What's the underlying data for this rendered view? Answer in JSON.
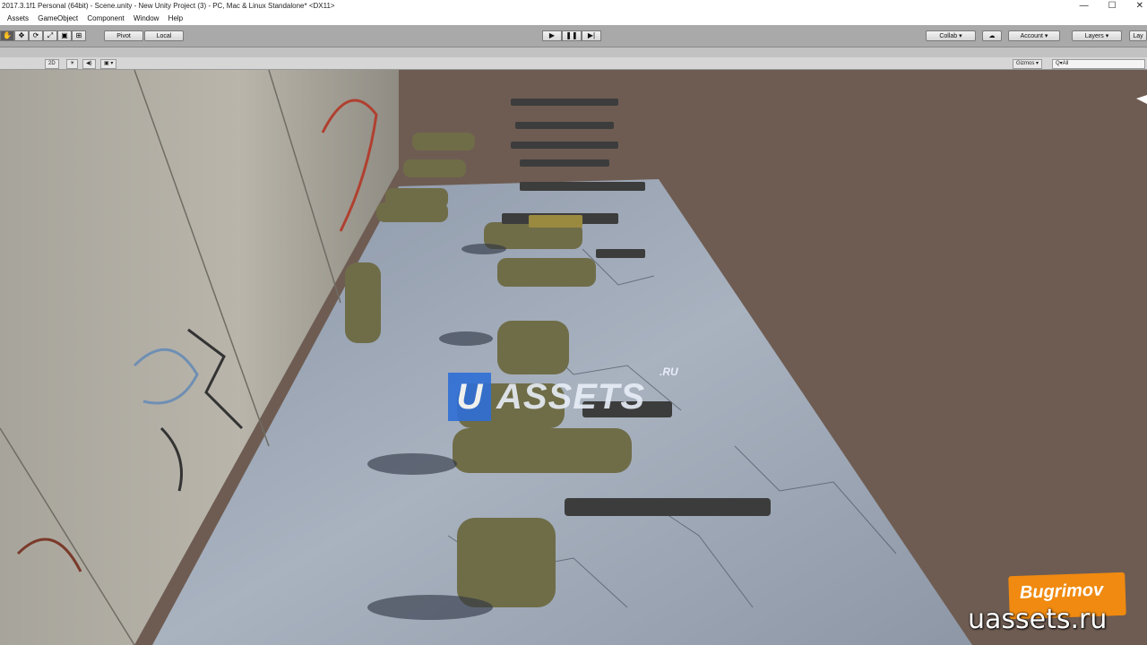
{
  "window": {
    "title": "2017.3.1f1 Personal (64bit) - Scene.unity - New Unity Project (3) - PC, Mac & Linux Standalone* <DX11>",
    "minimize": "—",
    "maximize": "☐",
    "close": "✕"
  },
  "menu": [
    "Assets",
    "GameObject",
    "Component",
    "Window",
    "Help"
  ],
  "toolbar": {
    "tools": [
      "✋",
      "✥",
      "⟳",
      "⤢",
      "▣",
      "⊞"
    ],
    "pivot": "Pivot",
    "local": "Local",
    "play": "▶",
    "pause": "❚❚",
    "step": "▶|",
    "collab": "Collab ▾",
    "cloud": "☁",
    "account": "Account ▾",
    "layers": "Layers ▾",
    "layout": "Lay"
  },
  "scene_toolbar": {
    "mode_2d": "2D",
    "lighting": "☀",
    "audio": "◀)",
    "effects": "▣ ▾",
    "gizmos": "Gizmos ▾",
    "search_placeholder": "Q▾All"
  },
  "overlay": {
    "logo_u": "U",
    "logo_text": "ASSETS",
    "logo_ru": ".RU",
    "badge": "Bugrimov",
    "watermark": "uassets.ru"
  },
  "colors": {
    "viewport_bg": "#6e5c52",
    "logo_blue": "#2f6fd6",
    "badge_orange": "#f08a10"
  }
}
